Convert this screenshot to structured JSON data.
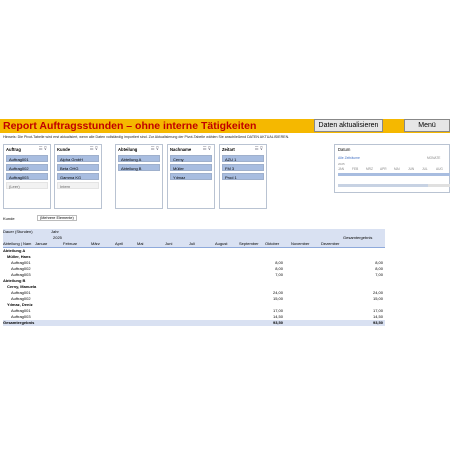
{
  "header": {
    "title": "Report Auftragsstunden – ohne interne Tätigkeiten",
    "refresh_button": "Daten aktualisieren",
    "menu_button": "Menü",
    "hint": "Hinweis: Die Pivot-Tabelle wird erst aktualisiert, wenn alle Daten vollständig importiert sind. Zur Aktualisierung der Pivot-Tabelle wählen Sie anschließend DATEN AKTUALISIEREN."
  },
  "slicers": [
    {
      "title": "Auftrag",
      "items": [
        {
          "label": "Auftrag001",
          "selected": true
        },
        {
          "label": "Auftrag002",
          "selected": true
        },
        {
          "label": "Auftrag003",
          "selected": true
        },
        {
          "label": "(Leer)",
          "selected": false
        }
      ]
    },
    {
      "title": "Kunde",
      "items": [
        {
          "label": "Alpha GmbH",
          "selected": true
        },
        {
          "label": "Beta OHG",
          "selected": true
        },
        {
          "label": "Gamma KG",
          "selected": true
        },
        {
          "label": "Intern",
          "selected": false
        }
      ]
    },
    {
      "title": "Abteilung",
      "items": [
        {
          "label": "Abteilung A",
          "selected": true
        },
        {
          "label": "Abteilung B",
          "selected": true
        }
      ]
    },
    {
      "title": "Nachname",
      "items": [
        {
          "label": "Cerny",
          "selected": true
        },
        {
          "label": "Müller",
          "selected": true
        },
        {
          "label": "Yılmaz",
          "selected": true
        }
      ]
    },
    {
      "title": "Zeitart",
      "items": [
        {
          "label": "AZU 1",
          "selected": true
        },
        {
          "label": "FM 3",
          "selected": true
        },
        {
          "label": "Prod 1",
          "selected": true
        }
      ]
    }
  ],
  "timeline": {
    "title": "Datum",
    "subtitle": "Alle Zeiträume",
    "level": "MONATE",
    "year": "2025",
    "months": [
      "JAN",
      "FEB",
      "MRZ",
      "APR",
      "MAI",
      "JUN",
      "JUL",
      "AUG"
    ]
  },
  "filter": {
    "label": "Kunde",
    "value": "(Mehrere Elemente)"
  },
  "pivot": {
    "value_field": "Dauer (Stunden)",
    "column_field": "Jahr",
    "year": "2025",
    "row_field": "Abteilung | Nam",
    "months": [
      "Januar",
      "Februar",
      "März",
      "April",
      "Mai",
      "Juni",
      "Juli",
      "August",
      "September",
      "Oktober",
      "November",
      "Dezember"
    ],
    "total_header": "Gesamtergebnis",
    "rows": [
      {
        "label": "Abteilung A",
        "level": 0,
        "bold": true,
        "okt": "",
        "total": ""
      },
      {
        "label": "Müller, Hans",
        "level": 1,
        "bold": true,
        "okt": "",
        "total": ""
      },
      {
        "label": "Auftrag001",
        "level": 2,
        "bold": false,
        "okt": "8,00",
        "total": "8,00"
      },
      {
        "label": "Auftrag002",
        "level": 2,
        "bold": false,
        "okt": "8,00",
        "total": "8,00"
      },
      {
        "label": "Auftrag003",
        "level": 2,
        "bold": false,
        "okt": "7,00",
        "total": "7,00"
      },
      {
        "label": "Abteilung B",
        "level": 0,
        "bold": true,
        "okt": "",
        "total": ""
      },
      {
        "label": "Cerny, Manuela",
        "level": 1,
        "bold": true,
        "okt": "",
        "total": ""
      },
      {
        "label": "Auftrag001",
        "level": 2,
        "bold": false,
        "okt": "24,00",
        "total": "24,00"
      },
      {
        "label": "Auftrag002",
        "level": 2,
        "bold": false,
        "okt": "15,00",
        "total": "15,00"
      },
      {
        "label": "Yılmaz, Deniz",
        "level": 1,
        "bold": true,
        "okt": "",
        "total": ""
      },
      {
        "label": "Auftrag001",
        "level": 2,
        "bold": false,
        "okt": "17,00",
        "total": "17,00"
      },
      {
        "label": "Auftrag003",
        "level": 2,
        "bold": false,
        "okt": "14,50",
        "total": "14,50"
      }
    ],
    "grand_total": {
      "label": "Gesamtergebnis",
      "okt": "93,50",
      "total": "93,50"
    }
  }
}
